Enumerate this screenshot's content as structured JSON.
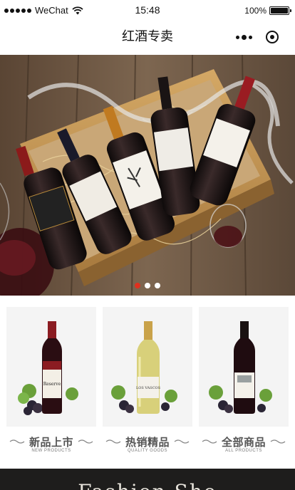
{
  "status_bar": {
    "carrier": "WeChat",
    "time": "15:48",
    "battery_percent": "100%",
    "battery_level": 1.0,
    "signal_icon": "signal-dots-icon",
    "wifi_icon": "wifi-icon"
  },
  "nav": {
    "title": "红酒专卖",
    "more_icon": "more-dots-icon",
    "close_icon": "close-miniprogram-icon"
  },
  "banner": {
    "slide_count": 3,
    "active_index": 0,
    "image": "wine-bottles-in-wooden-crate",
    "dot_active_color": "#e0301e",
    "dot_color": "#ffffff"
  },
  "categories": [
    {
      "title": "新品上市",
      "subtitle": "NEW PRODUCTS",
      "image": "red-wine-bottle-grapes"
    },
    {
      "title": "热销精品",
      "subtitle": "QUALITY GOODS",
      "image": "white-wine-bottle-grapes"
    },
    {
      "title": "全部商品",
      "subtitle": "ALL PRODUCTS",
      "image": "red-wine-bottle-grapes"
    }
  ],
  "bottom_banner": {
    "text": "Fashion Sho"
  }
}
